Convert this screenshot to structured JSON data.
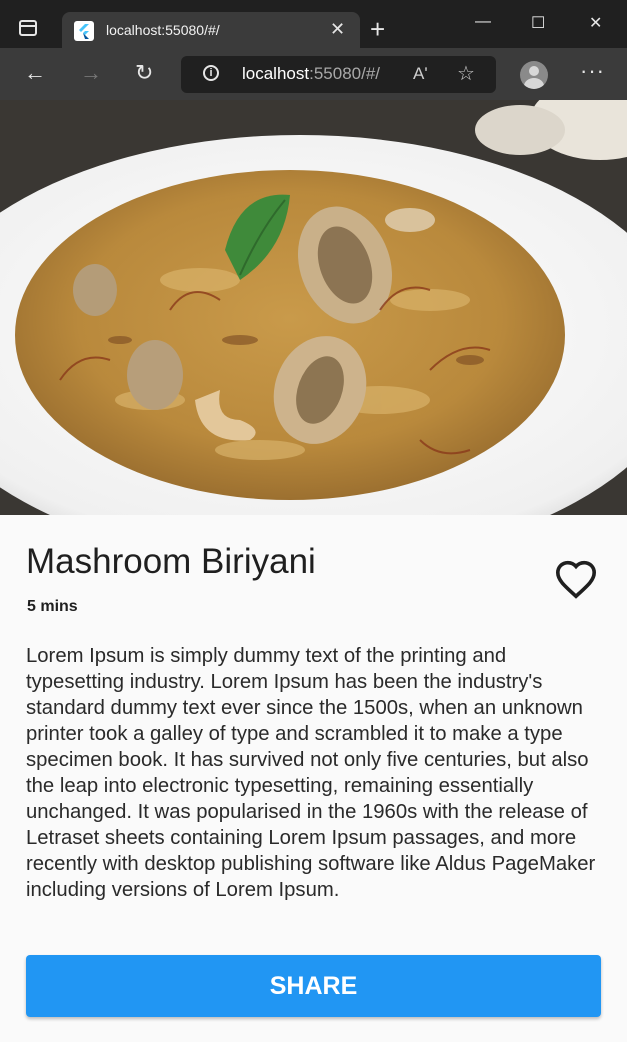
{
  "browser": {
    "tab_title": "localhost:55080/#/",
    "close_tab": "✕",
    "new_tab": "+",
    "url_host": "localhost",
    "url_rest": ":55080/#/",
    "window_minimize": "—",
    "window_maximize": "☐",
    "window_close": "✕",
    "back": "←",
    "forward": "→",
    "reload": "↻",
    "read_aloud": "Aʹ",
    "favorites": "☆",
    "more": "···"
  },
  "recipe": {
    "title": "Mashroom Biriyani",
    "time": "5 mins",
    "description": "Lorem Ipsum is simply dummy text of the printing and typesetting industry. Lorem Ipsum has been the industry's standard dummy text ever since the 1500s, when an unknown printer took a galley of type and scrambled it to make a type specimen book. It has survived not only five centuries, but also the leap into electronic typesetting, remaining essentially unchanged. It was popularised in the 1960s with the release of Letraset sheets containing Lorem Ipsum passages, and more recently with desktop publishing software like Aldus PageMaker including versions of Lorem Ipsum.",
    "share_label": "SHARE",
    "favorite_icon": "heart-outline-icon"
  },
  "colors": {
    "accent": "#2196f3",
    "page_bg": "#fafafa",
    "chrome_bg": "#202020",
    "toolbar_bg": "#3b3b3b"
  }
}
